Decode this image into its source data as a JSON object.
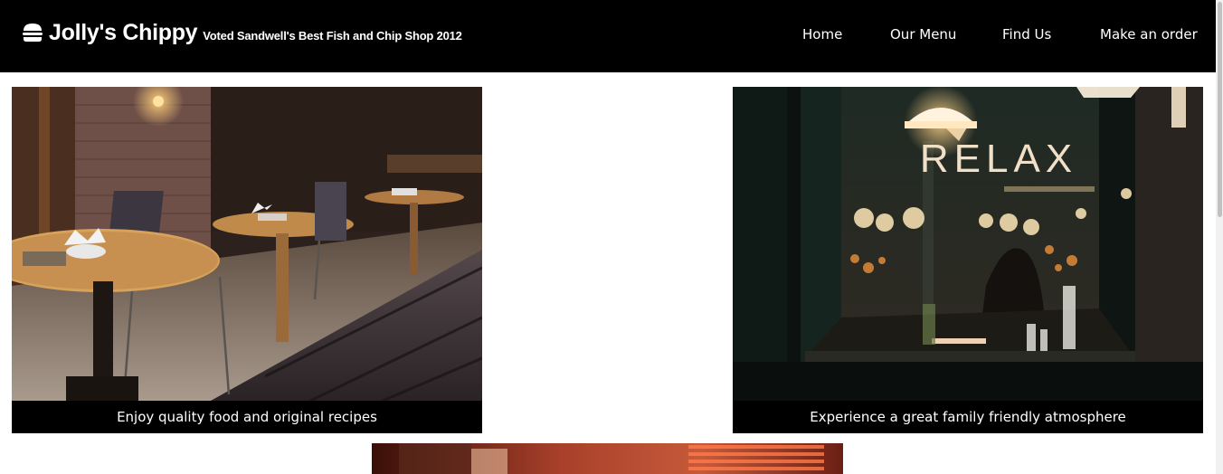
{
  "header": {
    "logo_icon": "burger-icon",
    "title": "Jolly's Chippy",
    "tagline": "Voted Sandwell's Best Fish and Chip Shop 2012"
  },
  "nav": {
    "home": "Home",
    "menu": "Our Menu",
    "find": "Find Us",
    "order": "Make an order"
  },
  "gallery": {
    "card1": {
      "caption": "Enjoy quality food and original recipes"
    },
    "card2": {
      "caption": "Experience a great family friendly atmosphere"
    },
    "card2_sign": "RELAX"
  },
  "colors": {
    "header_bg": "#000000",
    "caption_bg": "#000000",
    "text": "#ffffff"
  }
}
